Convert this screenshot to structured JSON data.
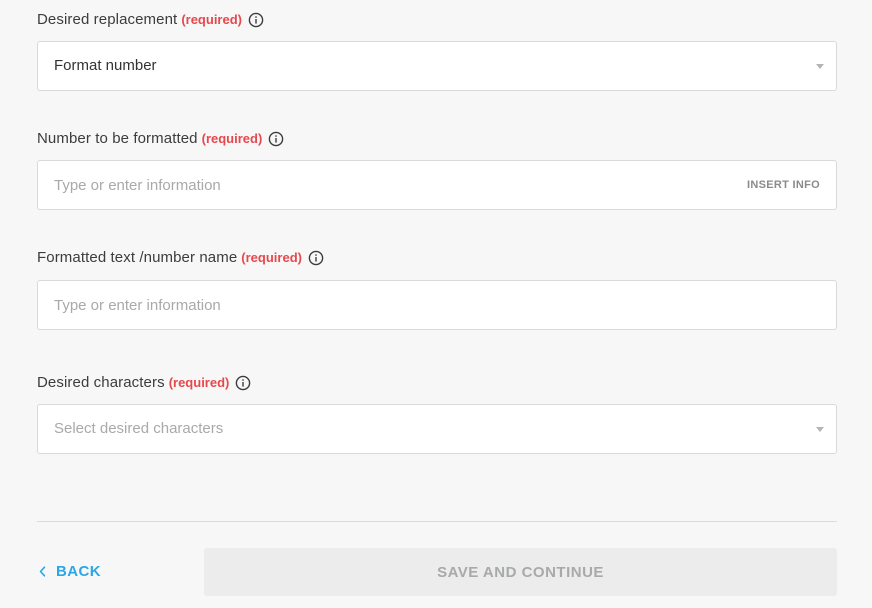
{
  "fields": [
    {
      "label": "Desired replacement",
      "required_text": "(required)",
      "type": "select",
      "value": "Format number",
      "placeholder": ""
    },
    {
      "label": "Number to be formatted",
      "required_text": "(required)",
      "type": "text",
      "value": "",
      "placeholder": "Type or enter information",
      "action_label": "INSERT INFO"
    },
    {
      "label": "Formatted text /number name",
      "required_text": "(required)",
      "type": "text",
      "value": "",
      "placeholder": "Type or enter information"
    },
    {
      "label": "Desired characters",
      "required_text": "(required)",
      "type": "select",
      "value": "",
      "placeholder": "Select desired characters"
    }
  ],
  "footer": {
    "back_label": "BACK",
    "save_label": "SAVE AND CONTINUE"
  },
  "colors": {
    "required": "#e5484d",
    "accent": "#2aa7e8",
    "disabled_text": "#a7a9ab",
    "disabled_bg": "#ececec"
  },
  "icons": {
    "info": "info-circle-icon",
    "dropdown": "caret-down-icon",
    "back": "chevron-left-icon"
  }
}
